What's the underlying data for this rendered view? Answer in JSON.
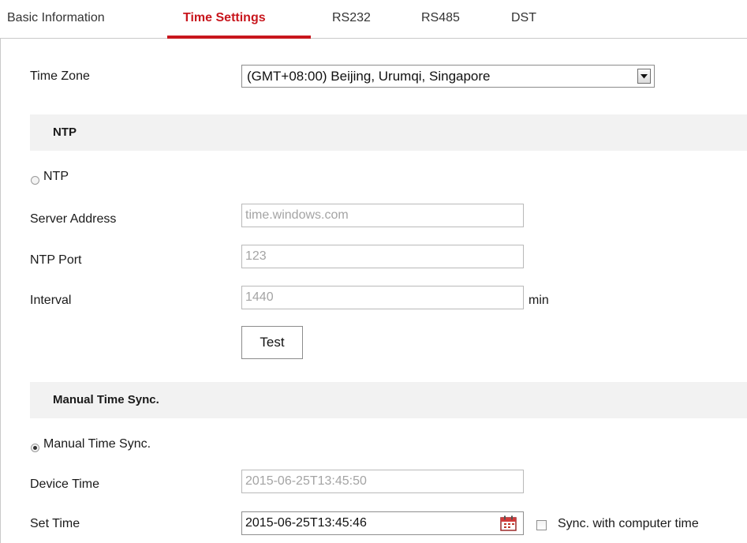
{
  "tabs": [
    {
      "label": "Basic Information",
      "active": false
    },
    {
      "label": "Time Settings",
      "active": true
    },
    {
      "label": "RS232",
      "active": false
    },
    {
      "label": "RS485",
      "active": false
    },
    {
      "label": "DST",
      "active": false
    }
  ],
  "time_zone": {
    "label": "Time Zone",
    "selected": "(GMT+08:00) Beijing, Urumqi, Singapore"
  },
  "ntp": {
    "section_title": "NTP",
    "radio_label": "NTP",
    "radio_checked": false,
    "server_address": {
      "label": "Server Address",
      "value": "time.windows.com"
    },
    "ntp_port": {
      "label": "NTP Port",
      "value": "123"
    },
    "interval": {
      "label": "Interval",
      "value": "1440",
      "unit": "min"
    },
    "test_button": "Test"
  },
  "manual": {
    "section_title": "Manual Time Sync.",
    "radio_label": "Manual Time Sync.",
    "radio_checked": true,
    "device_time": {
      "label": "Device Time",
      "value": "2015-06-25T13:45:50"
    },
    "set_time": {
      "label": "Set Time",
      "value": "2015-06-25T13:45:46",
      "icon": "calendar-icon"
    },
    "sync_checkbox": {
      "label": "Sync. with computer time",
      "checked": false
    }
  },
  "colors": {
    "accent": "#c8161d",
    "section_bg": "#f2f2f2",
    "disabled_text": "#a4a4a4"
  }
}
